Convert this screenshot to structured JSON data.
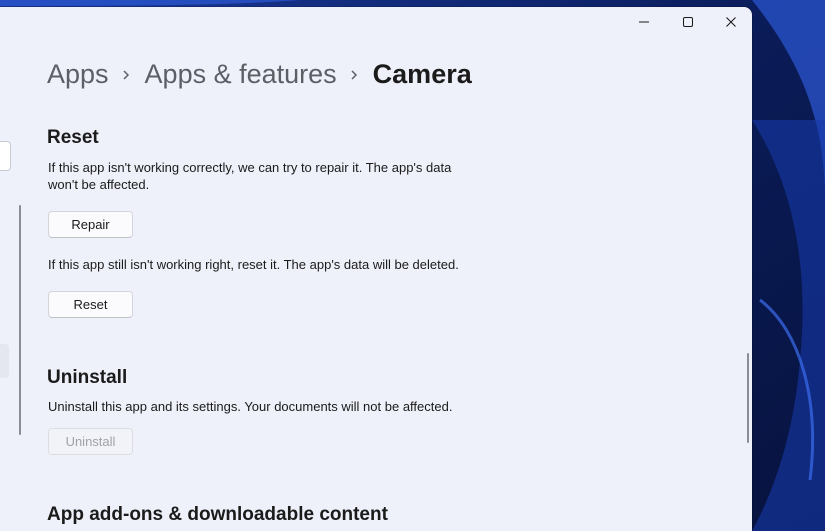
{
  "window": {
    "controls": {
      "minimize": "minimize-icon",
      "maximize": "maximize-icon",
      "close": "close-icon"
    }
  },
  "breadcrumb": {
    "items": [
      "Apps",
      "Apps & features",
      "Camera"
    ],
    "separator": "chevron-right-icon"
  },
  "reset_section": {
    "title": "Reset",
    "repair_description": "If this app isn't working correctly, we can try to repair it. The app's data won't be affected.",
    "repair_button": "Repair",
    "reset_description": "If this app still isn't working right, reset it. The app's data will be deleted.",
    "reset_button": "Reset"
  },
  "uninstall_section": {
    "title": "Uninstall",
    "description": "Uninstall this app and its settings. Your documents will not be affected.",
    "button": "Uninstall",
    "button_enabled": false
  },
  "addons_section": {
    "title": "App add-ons & downloadable content"
  },
  "colors": {
    "window_background": "#eef1f9",
    "wallpaper": "#0b1f5c",
    "text_primary": "#1b1b1b",
    "text_secondary": "#5c5f66"
  }
}
